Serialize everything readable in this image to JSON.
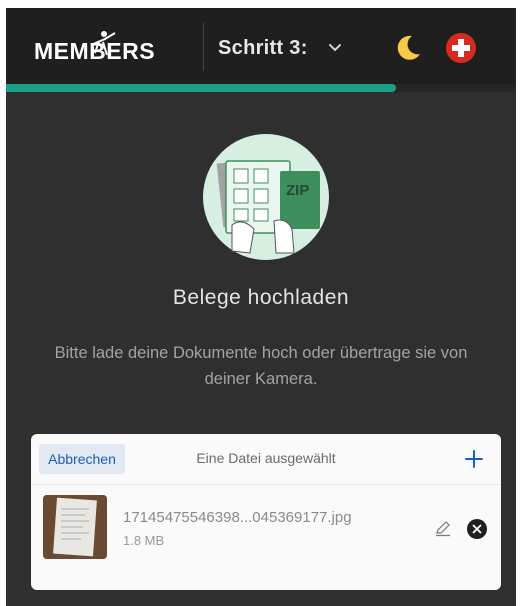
{
  "header": {
    "logo_text": "MEMBERS",
    "step_label": "Schritt 3:",
    "step_dropdown_icon": "chevron-down-icon",
    "theme_toggle_icon": "moon-icon",
    "language_icon": "swiss-flag-icon"
  },
  "progress": {
    "fraction": 0.765,
    "color": "#1aa085"
  },
  "main": {
    "title": "Belege hochladen",
    "description": "Bitte lade deine Dokumente hoch oder übertrage sie von deiner Kamera.",
    "illustration_text": "ZIP"
  },
  "uploader": {
    "cancel_label": "Abbrechen",
    "status_text": "Eine Datei ausgewählt",
    "add_icon": "plus-icon",
    "files": [
      {
        "name": "17145475546398...045369177.jpg",
        "size": "1.8 MB",
        "edit_icon": "pencil-icon",
        "remove_icon": "close-circle-icon"
      }
    ]
  },
  "colors": {
    "accent": "#1aa085",
    "background": "#2f2f2f",
    "topbar": "#1f1f1f",
    "link": "#1a5fb4"
  }
}
